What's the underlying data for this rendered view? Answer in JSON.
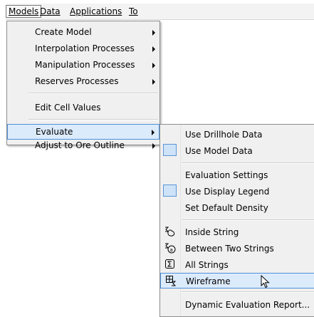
{
  "menubar": {
    "items": [
      "Models",
      "Data",
      "Applications",
      "To"
    ]
  },
  "models_menu": {
    "items": [
      {
        "label": "Create Model"
      },
      {
        "label": "Interpolation Processes"
      },
      {
        "label": "Manipulation Processes"
      },
      {
        "label": "Reserves Processes"
      },
      {
        "label": "Edit Cell Values"
      },
      {
        "label": "Evaluate"
      },
      {
        "label": "Adjust to Ore Outline"
      }
    ]
  },
  "evaluate_menu": {
    "items": [
      {
        "label": "Use Drillhole Data"
      },
      {
        "label": "Use Model Data",
        "checked": true
      },
      {
        "label": "Evaluation Settings"
      },
      {
        "label": "Use Display Legend",
        "checked": true
      },
      {
        "label": "Set Default Density"
      },
      {
        "label": "Inside String",
        "icon": "inside-string-icon"
      },
      {
        "label": "Between Two Strings",
        "icon": "between-strings-icon"
      },
      {
        "label": "All Strings",
        "icon": "all-strings-icon"
      },
      {
        "label": "Wireframe",
        "icon": "wireframe-icon"
      },
      {
        "label": "Dynamic Evaluation Report..."
      }
    ]
  },
  "colors": {
    "highlight_bg": "#dcebfc",
    "highlight_border": "#4f8fd6",
    "menu_bg": "#f0f0f0"
  }
}
